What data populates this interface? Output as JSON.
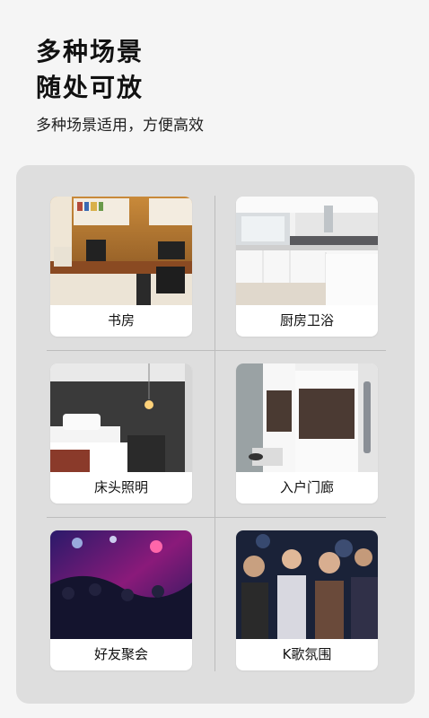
{
  "header": {
    "title_line1": "多种场景",
    "title_line2": "随处可放",
    "subtitle": "多种场景适用，方便高效"
  },
  "scenes": [
    {
      "label": "书房",
      "icon": "study-room-photo"
    },
    {
      "label": "厨房卫浴",
      "icon": "kitchen-bathroom-photo"
    },
    {
      "label": "床头照明",
      "icon": "bedside-lighting-photo"
    },
    {
      "label": "入户门廊",
      "icon": "entrance-hallway-photo"
    },
    {
      "label": "好友聚会",
      "icon": "friends-party-photo"
    },
    {
      "label": "K歌氛围",
      "icon": "karaoke-atmosphere-photo"
    }
  ]
}
